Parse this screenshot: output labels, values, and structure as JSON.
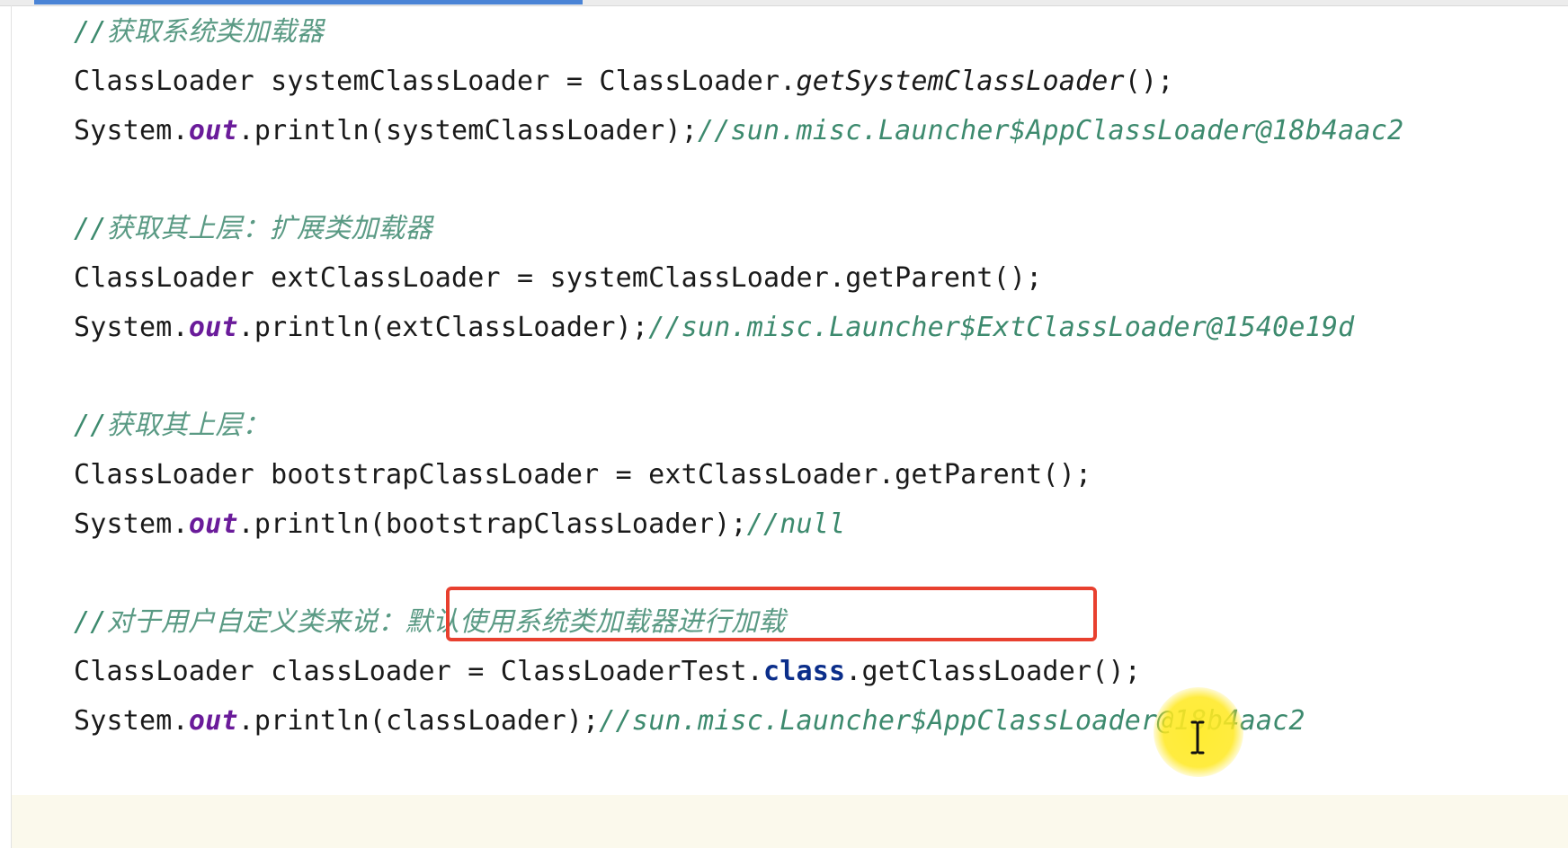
{
  "editor": {
    "lines": [
      {
        "type": "comment",
        "text": "//获取系统类加载器"
      },
      {
        "type": "code",
        "parts": [
          {
            "cls": "plain",
            "text": "ClassLoader systemClassLoader = ClassLoader."
          },
          {
            "cls": "italic",
            "text": "getSystemClassLoader"
          },
          {
            "cls": "plain",
            "text": "();"
          }
        ]
      },
      {
        "type": "code",
        "parts": [
          {
            "cls": "plain",
            "text": "System."
          },
          {
            "cls": "field",
            "text": "out"
          },
          {
            "cls": "plain",
            "text": ".println(systemClassLoader);"
          },
          {
            "cls": "comment",
            "text": "//sun.misc.Launcher$AppClassLoader@18b4aac2"
          }
        ]
      },
      {
        "type": "blank"
      },
      {
        "type": "comment",
        "text": "//获取其上层：扩展类加载器"
      },
      {
        "type": "code",
        "parts": [
          {
            "cls": "plain",
            "text": "ClassLoader extClassLoader = systemClassLoader.getParent();"
          }
        ]
      },
      {
        "type": "code",
        "parts": [
          {
            "cls": "plain",
            "text": "System."
          },
          {
            "cls": "field",
            "text": "out"
          },
          {
            "cls": "plain",
            "text": ".println(extClassLoader);"
          },
          {
            "cls": "comment",
            "text": "//sun.misc.Launcher$ExtClassLoader@1540e19d"
          }
        ]
      },
      {
        "type": "blank"
      },
      {
        "type": "comment",
        "text": "//获取其上层："
      },
      {
        "type": "code",
        "parts": [
          {
            "cls": "plain",
            "text": "ClassLoader bootstrapClassLoader = extClassLoader.getParent();"
          }
        ]
      },
      {
        "type": "code",
        "parts": [
          {
            "cls": "plain",
            "text": "System."
          },
          {
            "cls": "field",
            "text": "out"
          },
          {
            "cls": "plain",
            "text": ".println(bootstrapClassLoader);"
          },
          {
            "cls": "comment",
            "text": "//null"
          }
        ]
      },
      {
        "type": "blank"
      },
      {
        "type": "comment",
        "text": "//对于用户自定义类来说：默认使用系统类加载器进行加载"
      },
      {
        "type": "code",
        "parts": [
          {
            "cls": "plain",
            "text": "ClassLoader classLoader = ClassLoaderTest."
          },
          {
            "cls": "keyword",
            "text": "class"
          },
          {
            "cls": "plain",
            "text": ".getClassLoader();"
          }
        ]
      },
      {
        "type": "code",
        "parts": [
          {
            "cls": "plain",
            "text": "System."
          },
          {
            "cls": "field",
            "text": "out"
          },
          {
            "cls": "plain",
            "text": ".println(classLoader);"
          },
          {
            "cls": "comment",
            "text": "//sun.misc.Launcher$AppClassLoader@18b4aac2"
          }
        ]
      }
    ]
  },
  "colors": {
    "comment": "#3d8a6e",
    "field": "#6a1b9a",
    "keyword": "#0b2e8a",
    "highlight_border": "#e8402f",
    "cursor_highlight": "#ffeb28"
  },
  "icons": {
    "cursor": "text-cursor-icon"
  }
}
